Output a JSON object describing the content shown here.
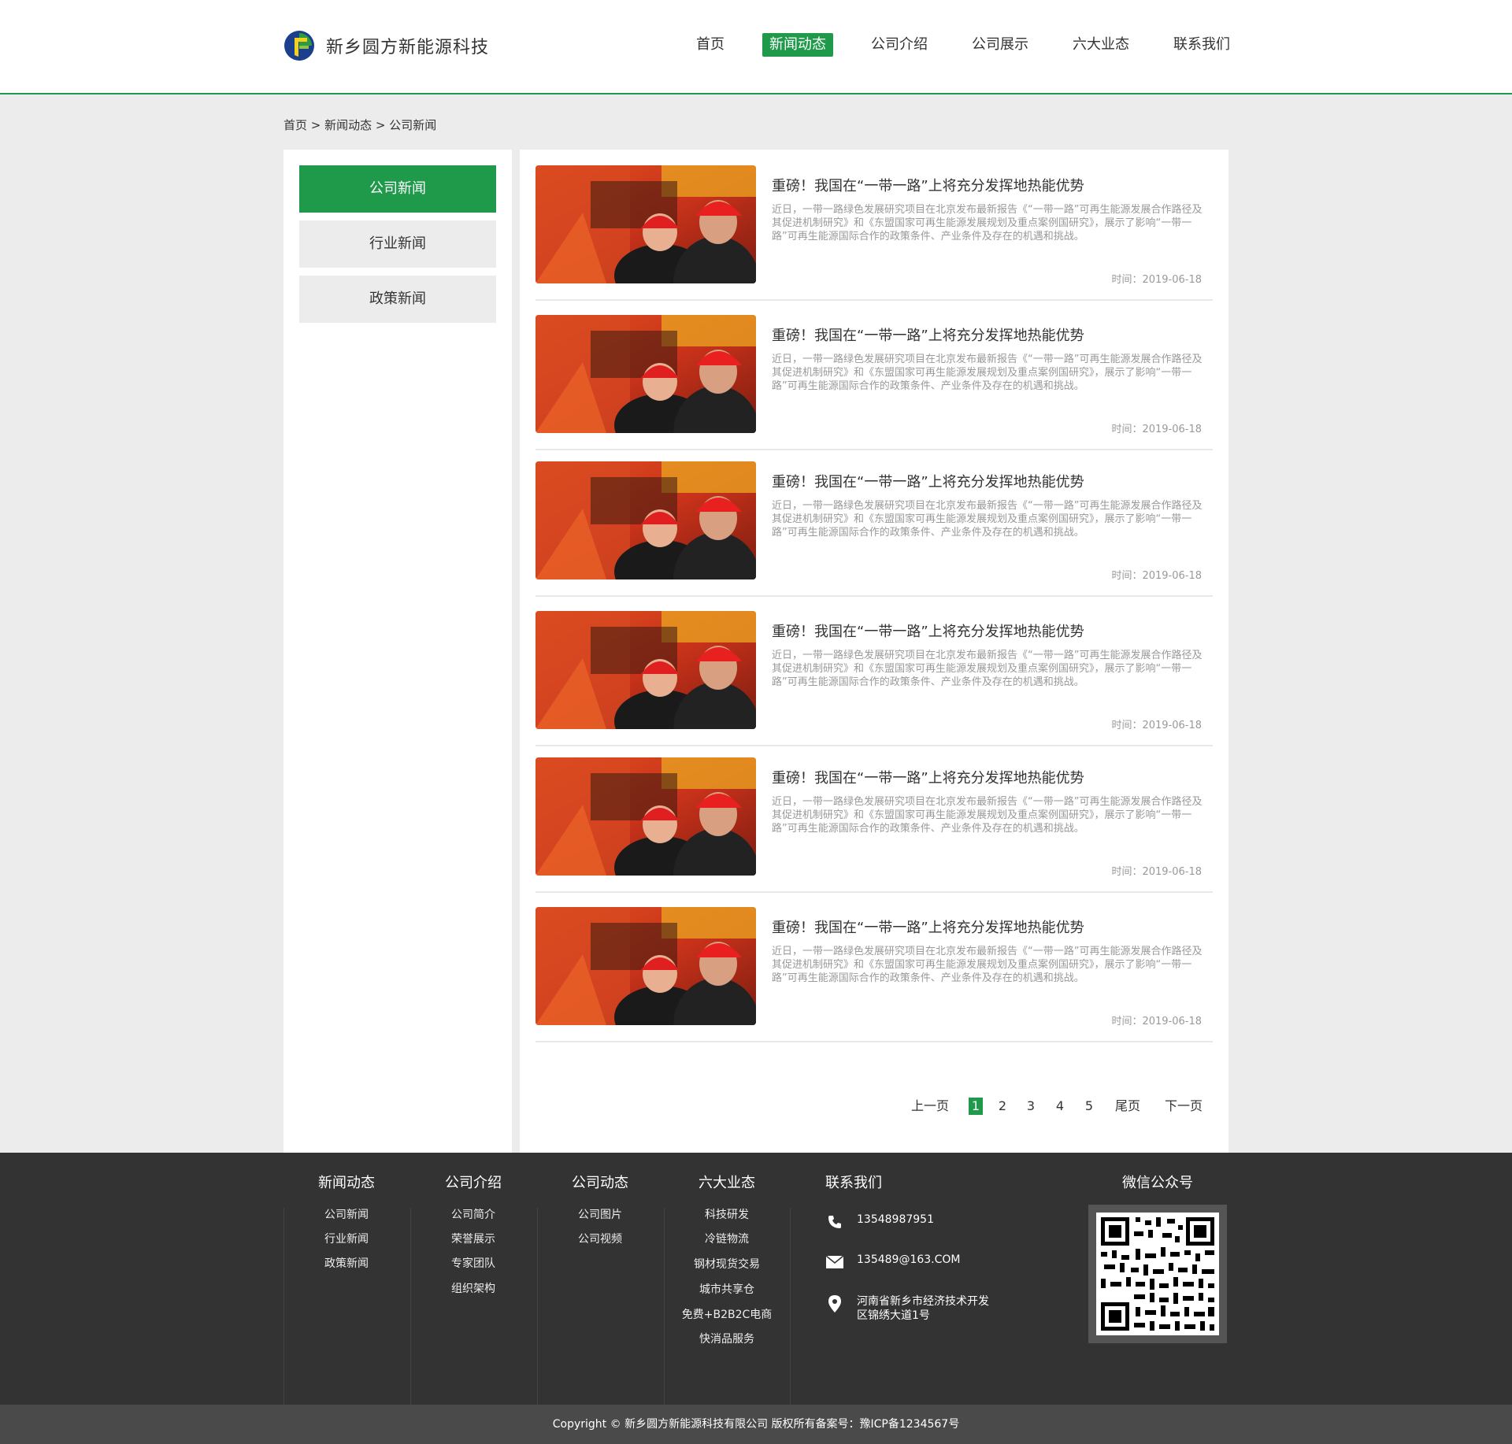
{
  "brand": {
    "name": "新乡圆方新能源科技",
    "accent": "#1f9a4a"
  },
  "nav": [
    {
      "label": "首页",
      "active": false
    },
    {
      "label": "新闻动态",
      "active": true
    },
    {
      "label": "公司介绍",
      "active": false
    },
    {
      "label": "公司展示",
      "active": false
    },
    {
      "label": "六大业态",
      "active": false
    },
    {
      "label": "联系我们",
      "active": false
    }
  ],
  "breadcrumb": "首页 > 新闻动态 > 公司新闻",
  "sidebar": [
    {
      "label": "公司新闻",
      "active": true
    },
    {
      "label": "行业新闻",
      "active": false
    },
    {
      "label": "政策新闻",
      "active": false
    }
  ],
  "news": [
    {
      "title": "重磅！我国在“一带一路”上将充分发挥地热能优势",
      "desc": "近日，一带一路绿色发展研究项目在北京发布最新报告《“一带一路”可再生能源发展合作路径及其促进机制研究》和《东盟国家可再生能源发展规划及重点案例国研究》，展示了影响“一带一路”可再生能源国际合作的政策条件、产业条件及存在的机遇和挑战。",
      "date": "时间：2019-06-18"
    },
    {
      "title": "重磅！我国在“一带一路”上将充分发挥地热能优势",
      "desc": "近日，一带一路绿色发展研究项目在北京发布最新报告《“一带一路”可再生能源发展合作路径及其促进机制研究》和《东盟国家可再生能源发展规划及重点案例国研究》，展示了影响“一带一路”可再生能源国际合作的政策条件、产业条件及存在的机遇和挑战。",
      "date": "时间：2019-06-18"
    },
    {
      "title": "重磅！我国在“一带一路”上将充分发挥地热能优势",
      "desc": "近日，一带一路绿色发展研究项目在北京发布最新报告《“一带一路”可再生能源发展合作路径及其促进机制研究》和《东盟国家可再生能源发展规划及重点案例国研究》，展示了影响“一带一路”可再生能源国际合作的政策条件、产业条件及存在的机遇和挑战。",
      "date": "时间：2019-06-18"
    },
    {
      "title": "重磅！我国在“一带一路”上将充分发挥地热能优势",
      "desc": "近日，一带一路绿色发展研究项目在北京发布最新报告《“一带一路”可再生能源发展合作路径及其促进机制研究》和《东盟国家可再生能源发展规划及重点案例国研究》，展示了影响“一带一路”可再生能源国际合作的政策条件、产业条件及存在的机遇和挑战。",
      "date": "时间：2019-06-18"
    },
    {
      "title": "重磅！我国在“一带一路”上将充分发挥地热能优势",
      "desc": "近日，一带一路绿色发展研究项目在北京发布最新报告《“一带一路”可再生能源发展合作路径及其促进机制研究》和《东盟国家可再生能源发展规划及重点案例国研究》，展示了影响“一带一路”可再生能源国际合作的政策条件、产业条件及存在的机遇和挑战。",
      "date": "时间：2019-06-18"
    },
    {
      "title": "重磅！我国在“一带一路”上将充分发挥地热能优势",
      "desc": "近日，一带一路绿色发展研究项目在北京发布最新报告《“一带一路”可再生能源发展合作路径及其促进机制研究》和《东盟国家可再生能源发展规划及重点案例国研究》，展示了影响“一带一路”可再生能源国际合作的政策条件、产业条件及存在的机遇和挑战。",
      "date": "时间：2019-06-18"
    }
  ],
  "pager": {
    "prev": "上一页",
    "pages": [
      "1",
      "2",
      "3",
      "4",
      "5"
    ],
    "current": "1",
    "last": "尾页",
    "next": "下一页"
  },
  "footer": {
    "columns": [
      {
        "title": "新闻动态",
        "links": [
          "公司新闻",
          "行业新闻",
          "政策新闻"
        ]
      },
      {
        "title": "公司介绍",
        "links": [
          "公司简介",
          "荣誉展示",
          "专家团队",
          "组织架构"
        ]
      },
      {
        "title": "公司动态",
        "links": [
          "公司图片",
          "公司视频"
        ]
      },
      {
        "title": "六大业态",
        "links": [
          "科技研发",
          "冷链物流",
          "钢材现货交易",
          "城市共享仓",
          "免费+B2B2C电商",
          "快消品服务"
        ]
      }
    ],
    "contact": {
      "title": "联系我们",
      "phone": "13548987951",
      "email": "135489@163.COM",
      "address_line1": "河南省新乡市经济技术开发",
      "address_line2": "区锦绣大道1号"
    },
    "wechat_title": "微信公众号",
    "copyright": "Copyright ©    新乡圆方新能源科技有限公司 版权所有备案号：豫ICP备1234567号"
  }
}
